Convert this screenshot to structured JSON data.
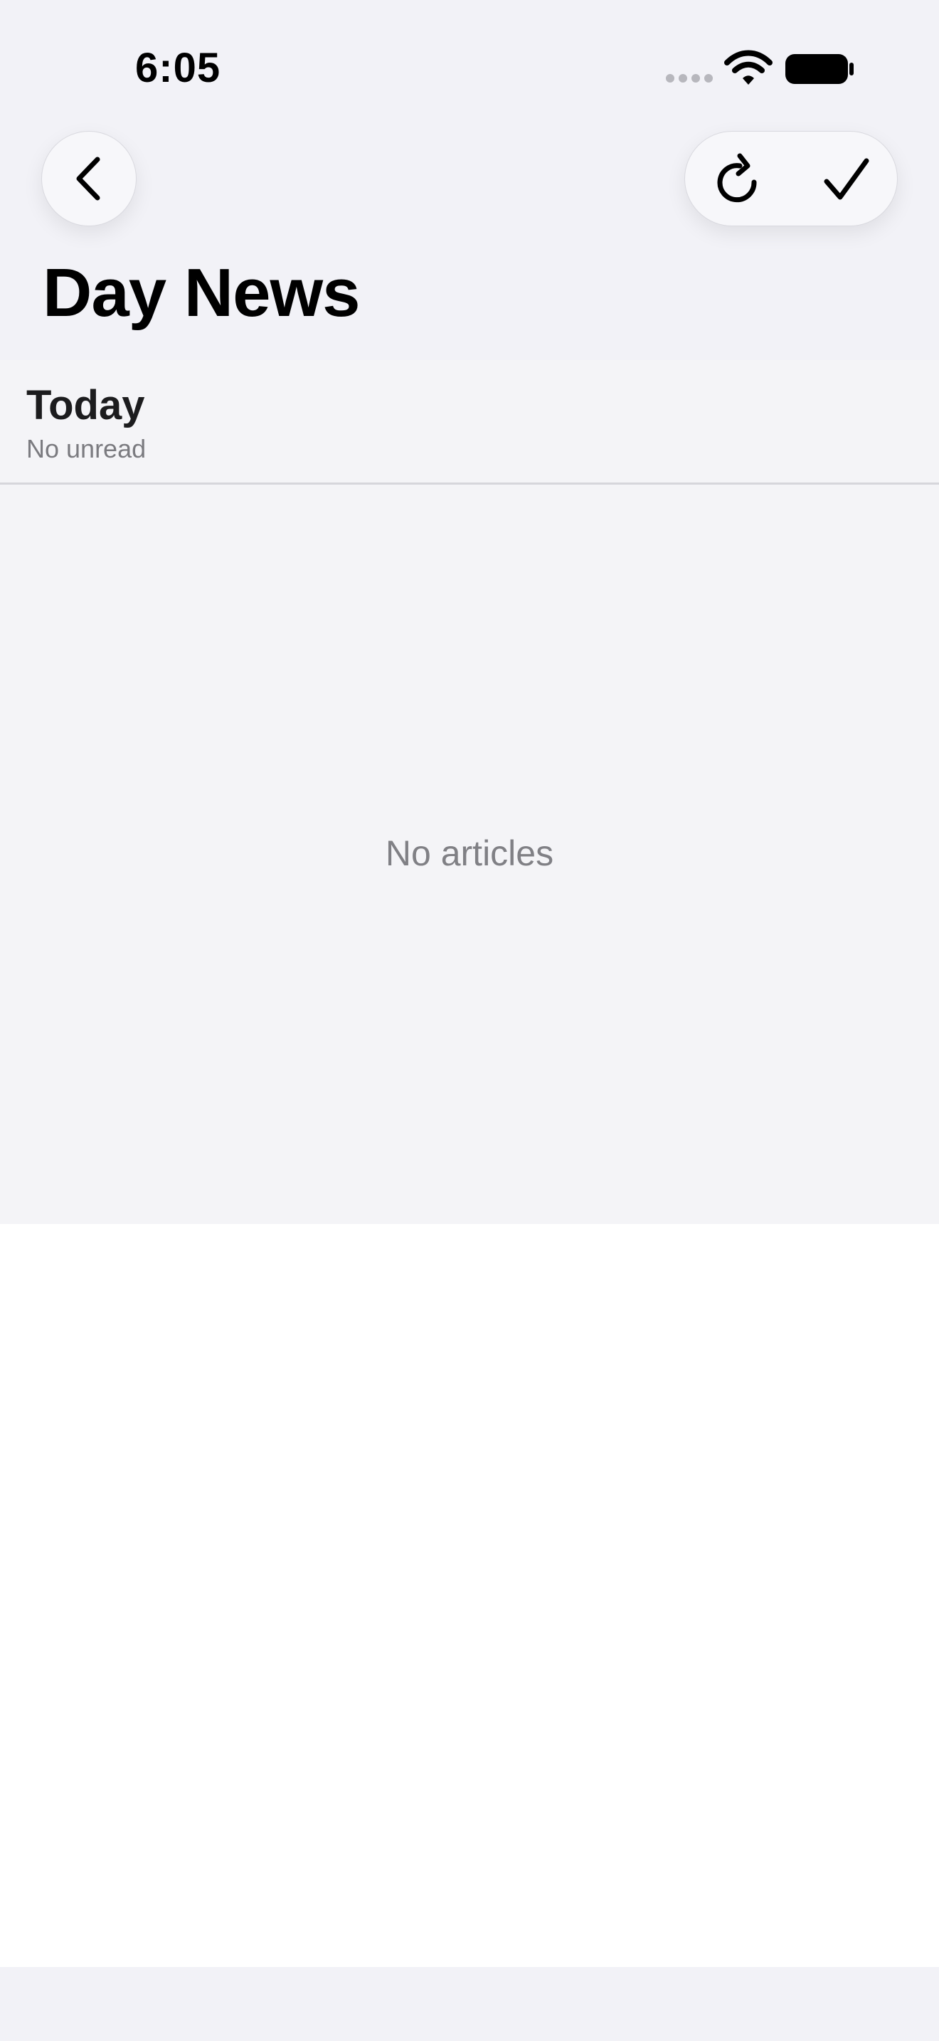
{
  "status_bar": {
    "time": "6:05",
    "icons": [
      "cellular-signal-icon",
      "wifi-icon",
      "battery-icon"
    ]
  },
  "navigation": {
    "back_icon": "chevron-left-icon",
    "refresh_icon": "refresh-icon",
    "mark_read_icon": "checkmark-icon"
  },
  "page": {
    "title": "Day News"
  },
  "section": {
    "title": "Today",
    "subtitle": "No unread"
  },
  "empty_state": {
    "message": "No articles"
  },
  "colors": {
    "background": "#f2f2f7",
    "panel": "#f4f4f7",
    "text_primary": "#000000",
    "text_secondary": "#7b7b80",
    "divider": "#d6d6db"
  }
}
